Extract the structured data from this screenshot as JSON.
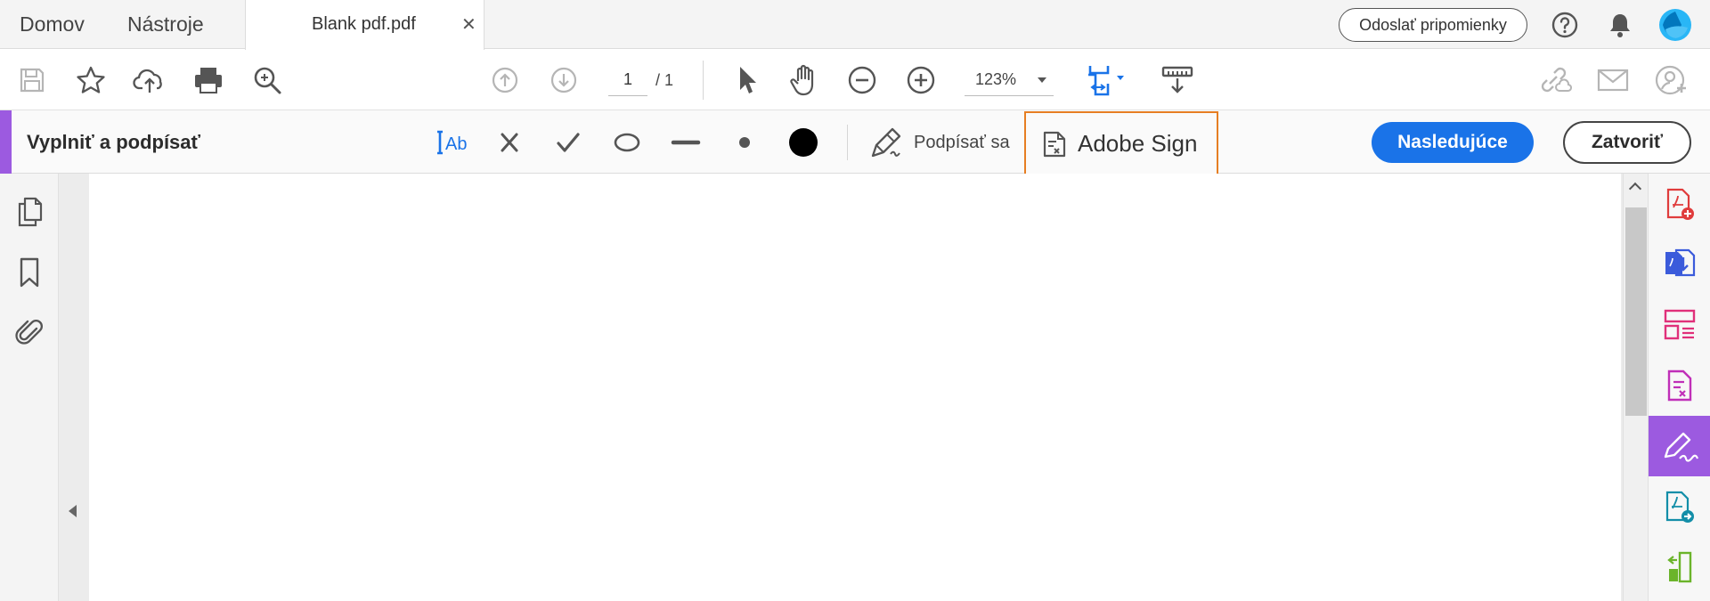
{
  "tabbar": {
    "home": "Domov",
    "tools": "Nástroje",
    "document_tab": "Blank pdf.pdf",
    "close_glyph": "✕",
    "feedback": "Odoslať pripomienky"
  },
  "toolbar": {
    "page_current": "1",
    "page_total": "/ 1",
    "zoom": "123%"
  },
  "fill_sign": {
    "title": "Vyplniť a podpísať",
    "text_tool": "Ab",
    "sign_label": "Podpísať sa",
    "adobe_sign_label": "Adobe Sign",
    "next_label": "Nasledujúce",
    "close_label": "Zatvoriť"
  },
  "colors": {
    "accent_purple": "#9c5ae0",
    "primary_blue": "#1a73e8",
    "highlight_orange": "#e67e22"
  }
}
